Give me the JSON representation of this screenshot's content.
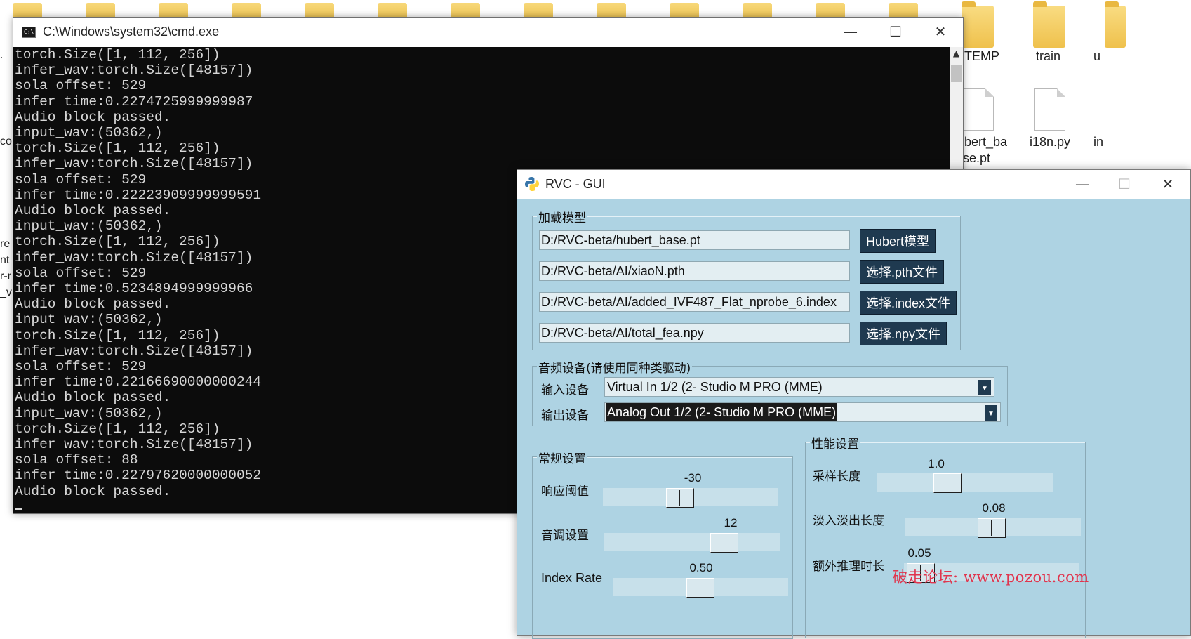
{
  "desktop": {
    "files": [
      {
        "name": "TEMP",
        "icon": "folder-icon"
      },
      {
        "name": "train",
        "icon": "folder-icon"
      },
      {
        "name": "u",
        "icon": "folder-icon"
      },
      {
        "name": "bert_ba",
        "name2": "se.pt",
        "icon": "file-icon"
      },
      {
        "name": "i18n.py",
        "icon": "file-icon"
      },
      {
        "name": "in",
        "icon": "file-icon"
      }
    ],
    "edge_fragments": [
      ".",
      "co",
      "re",
      "nt",
      "r-r",
      "_v"
    ]
  },
  "cmd": {
    "title": "C:\\Windows\\system32\\cmd.exe",
    "minimize": "—",
    "maximize": "☐",
    "close": "✕",
    "lines": [
      "torch.Size([1, 112, 256])",
      "infer_wav:torch.Size([48157])",
      "sola offset: 529",
      "infer time:0.2274725999999987",
      "Audio block passed.",
      "input_wav:(50362,)",
      "torch.Size([1, 112, 256])",
      "infer_wav:torch.Size([48157])",
      "sola offset: 529",
      "infer time:0.22223909999999591",
      "Audio block passed.",
      "input_wav:(50362,)",
      "torch.Size([1, 112, 256])",
      "infer_wav:torch.Size([48157])",
      "sola offset: 529",
      "infer time:0.5234894999999966",
      "Audio block passed.",
      "input_wav:(50362,)",
      "torch.Size([1, 112, 256])",
      "infer_wav:torch.Size([48157])",
      "sola offset: 529",
      "infer time:0.22166690000000244",
      "Audio block passed.",
      "input_wav:(50362,)",
      "torch.Size([1, 112, 256])",
      "infer_wav:torch.Size([48157])",
      "sola offset: 88",
      "infer time:0.22797620000000052",
      "Audio block passed."
    ]
  },
  "rvc": {
    "title": "RVC - GUI",
    "minimize": "—",
    "maximize": "☐",
    "close": "✕",
    "load_model": {
      "title": "加载模型",
      "rows": [
        {
          "value": "D:/RVC-beta/hubert_base.pt",
          "button": "Hubert模型"
        },
        {
          "value": "D:/RVC-beta/AI/xiaoN.pth",
          "button": "选择.pth文件"
        },
        {
          "value": "D:/RVC-beta/AI/added_IVF487_Flat_nprobe_6.index",
          "button": "选择.index文件"
        },
        {
          "value": "D:/RVC-beta/AI/total_fea.npy",
          "button": "选择.npy文件"
        }
      ]
    },
    "audio_device": {
      "title": "音频设备(请使用同种类驱动)",
      "input_label": "输入设备",
      "input_value": "Virtual In 1/2 (2- Studio M PRO (MME)",
      "output_label": "输出设备",
      "output_value": "Analog Out 1/2 (2- Studio M PRO (MME)"
    },
    "general": {
      "title": "常规设置",
      "sliders": [
        {
          "label": "响应阈值",
          "value": "-30",
          "min": -60,
          "max": 0,
          "level": 0.43
        },
        {
          "label": "音调设置",
          "value": "12",
          "min": -24,
          "max": 24,
          "level": 0.72
        },
        {
          "label": "Index Rate",
          "value": "0.50",
          "min": 0,
          "max": 1,
          "level": 0.5
        }
      ]
    },
    "performance": {
      "title": "性能设置",
      "sliders": [
        {
          "label": "采样长度",
          "value": "1.0",
          "level": 0.38
        },
        {
          "label": "淡入淡出长度",
          "value": "0.08",
          "level": 0.49
        },
        {
          "label": "额外推理时长",
          "value": "0.05",
          "level": 0.02
        }
      ]
    }
  },
  "watermark": "破走论坛: www.pozou.com"
}
